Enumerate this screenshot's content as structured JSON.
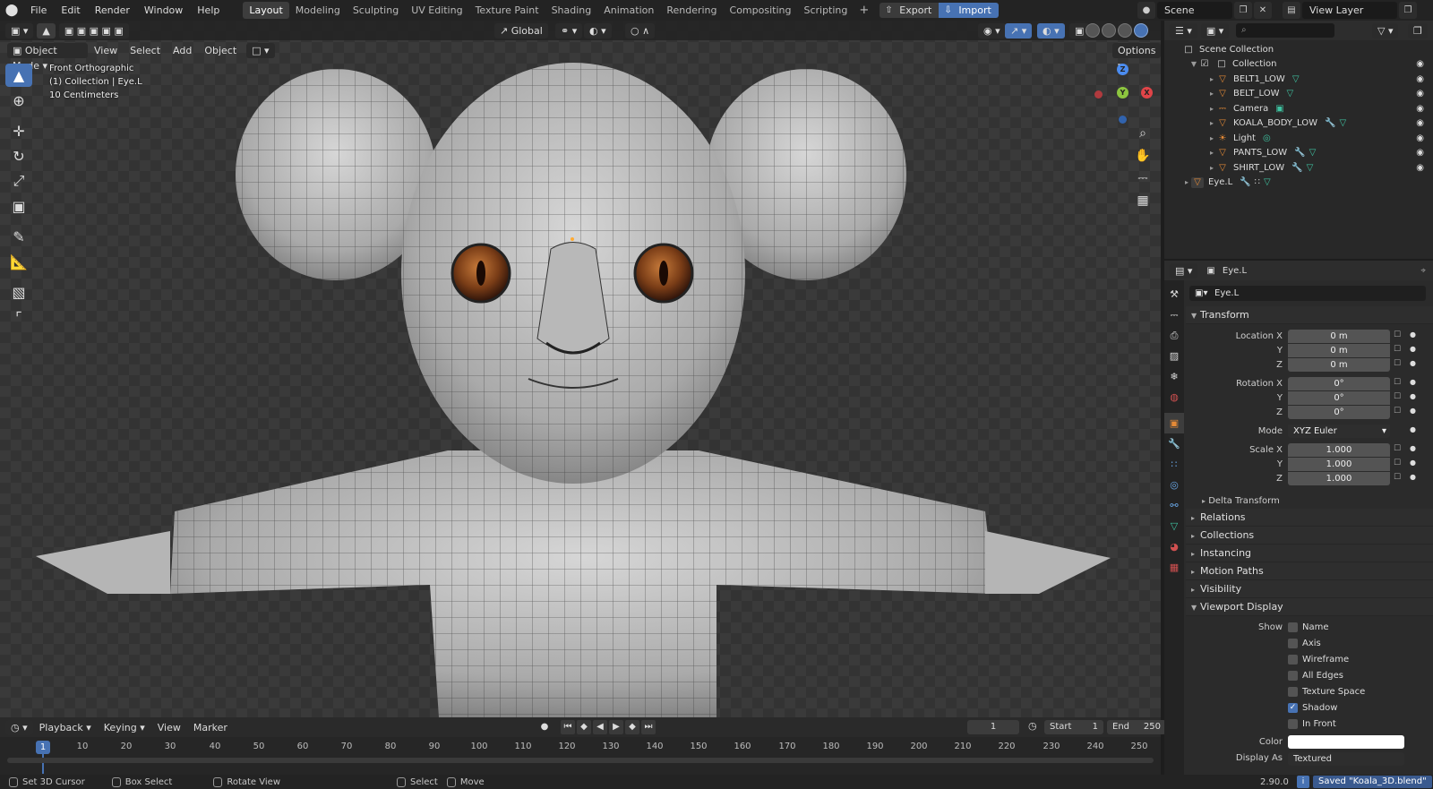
{
  "topbar": {
    "menus": [
      "File",
      "Edit",
      "Render",
      "Window",
      "Help"
    ],
    "workspaces": [
      "Layout",
      "Modeling",
      "Sculpting",
      "UV Editing",
      "Texture Paint",
      "Shading",
      "Animation",
      "Rendering",
      "Compositing",
      "Scripting"
    ],
    "active_workspace": "Layout",
    "export_label": "Export",
    "import_label": "Import",
    "scene": "Scene",
    "view_layer": "View Layer"
  },
  "viewport": {
    "mode": "Object Mode",
    "menus": [
      "View",
      "Select",
      "Add",
      "Object"
    ],
    "orientation": "Global",
    "options_label": "Options",
    "info": {
      "view": "Front Orthographic",
      "collection": "(1) Collection | Eye.L",
      "scale": "10 Centimeters"
    },
    "gizmo": {
      "z": "Z",
      "y": "Y",
      "x": "X"
    }
  },
  "timeline": {
    "menus": [
      "Playback",
      "Keying",
      "View",
      "Marker"
    ],
    "current_frame": "1",
    "start_label": "Start",
    "start": "1",
    "end_label": "End",
    "end": "250",
    "ruler": [
      "10",
      "20",
      "30",
      "40",
      "50",
      "60",
      "70",
      "80",
      "90",
      "100",
      "110",
      "120",
      "130",
      "140",
      "150",
      "160",
      "170",
      "180",
      "190",
      "200",
      "210",
      "220",
      "230",
      "240",
      "250"
    ]
  },
  "statusbar": {
    "items": [
      "Set 3D Cursor",
      "Box Select",
      "Rotate View",
      "Select",
      "Move"
    ],
    "version": "2.90.0",
    "saved": "Saved \"Koala_3D.blend\""
  },
  "outliner": {
    "root": "Scene Collection",
    "collection": "Collection",
    "objects": [
      "BELT1_LOW",
      "BELT_LOW",
      "Camera",
      "KOALA_BODY_LOW",
      "Light",
      "PANTS_LOW",
      "SHIRT_LOW"
    ],
    "eye_object": "Eye.L"
  },
  "properties": {
    "object_name": "Eye.L",
    "transform_title": "Transform",
    "location_label": "Location X",
    "rotation_label": "Rotation X",
    "scale_label": "Scale X",
    "y_label": "Y",
    "z_label": "Z",
    "location": [
      "0 m",
      "0 m",
      "0 m"
    ],
    "rotation": [
      "0°",
      "0°",
      "0°"
    ],
    "mode_label": "Mode",
    "mode": "XYZ Euler",
    "scale": [
      "1.000",
      "1.000",
      "1.000"
    ],
    "delta": "Delta Transform",
    "panels": [
      "Relations",
      "Collections",
      "Instancing",
      "Motion Paths",
      "Visibility"
    ],
    "viewport_display": "Viewport Display",
    "show_label": "Show",
    "show_items": [
      "Name",
      "Axis",
      "Wireframe",
      "All Edges",
      "Texture Space",
      "Shadow",
      "In Front"
    ],
    "color_label": "Color",
    "display_as_label": "Display As",
    "display_as": "Textured"
  }
}
